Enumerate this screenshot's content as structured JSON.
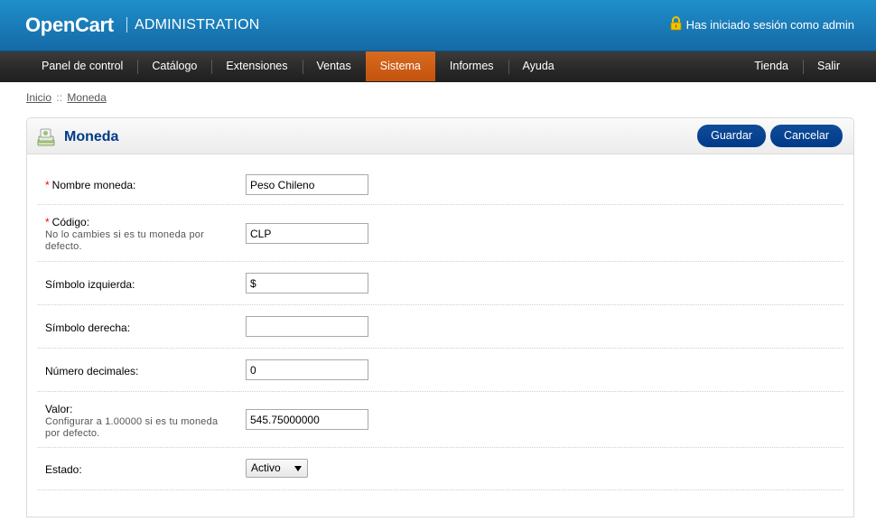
{
  "header": {
    "logo": "OpenCart",
    "subtitle": "ADMINISTRATION",
    "login_text": "Has iniciado sesión como admin",
    "login_icon": "lock-icon"
  },
  "menu": {
    "left": [
      "Panel de control",
      "Catálogo",
      "Extensiones",
      "Ventas",
      "Sistema",
      "Informes",
      "Ayuda"
    ],
    "active": "Sistema",
    "right": [
      "Tienda",
      "Salir"
    ]
  },
  "breadcrumb": {
    "items": [
      "Inicio",
      "Moneda"
    ],
    "separator": "::"
  },
  "box": {
    "title": "Moneda",
    "title_icon": "money-icon",
    "save_label": "Guardar",
    "cancel_label": "Cancelar"
  },
  "form": {
    "name": {
      "label": "Nombre moneda:",
      "required": "*",
      "value": "Peso Chileno"
    },
    "code": {
      "label": "Código:",
      "required": "*",
      "help": "No lo cambies si es tu moneda por defecto.",
      "value": "CLP"
    },
    "symbol_left": {
      "label": "Símbolo izquierda:",
      "value": "$"
    },
    "symbol_right": {
      "label": "Símbolo derecha:",
      "value": ""
    },
    "decimal_place": {
      "label": "Número decimales:",
      "value": "0"
    },
    "value": {
      "label": "Valor:",
      "help": "Configurar a 1.00000 si es tu moneda por defecto.",
      "value": "545.75000000"
    },
    "status": {
      "label": "Estado:",
      "selected": "Activo"
    }
  },
  "colors": {
    "header_blue": "#1a7cb8",
    "menu_dark": "#2b2b2b",
    "menu_active": "#c4520f",
    "title_blue": "#003a88",
    "button_blue": "#003a88",
    "required_red": "#ff0000"
  }
}
